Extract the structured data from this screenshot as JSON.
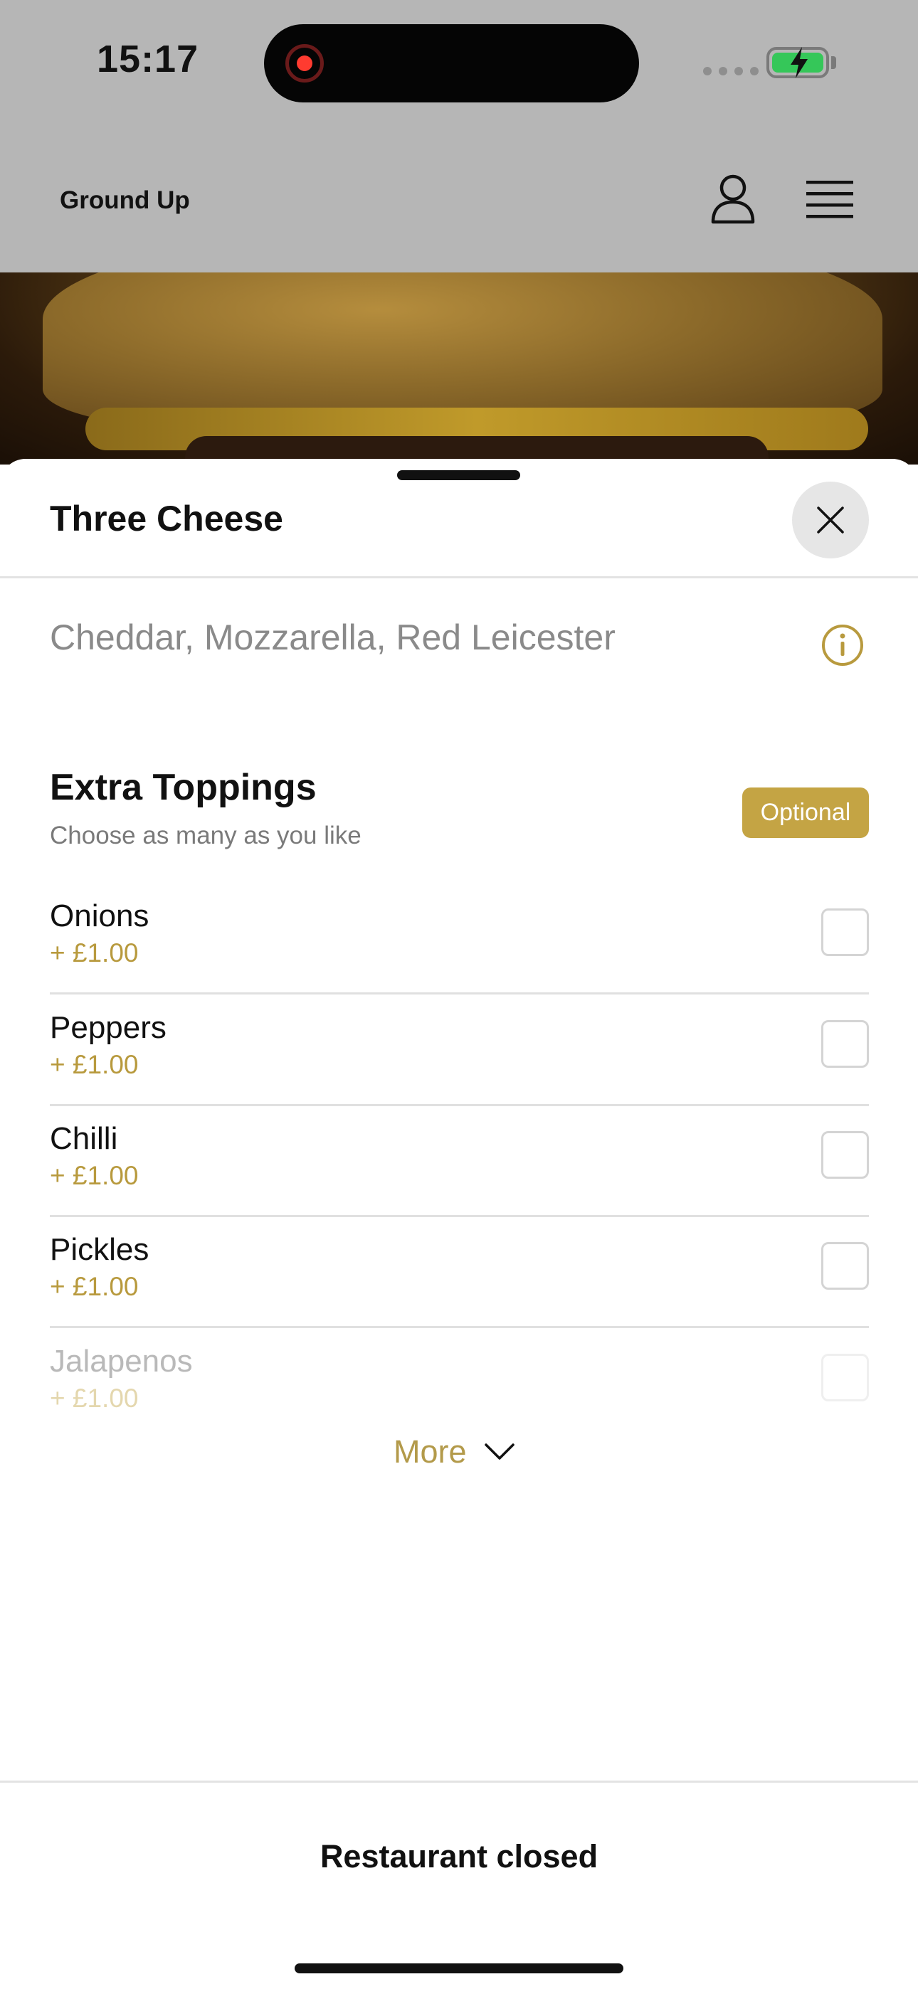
{
  "status_bar": {
    "time": "15:17"
  },
  "header": {
    "brand": "Ground Up"
  },
  "sheet": {
    "title": "Three Cheese",
    "description": "Cheddar, Mozzarella, Red Leicester"
  },
  "section": {
    "title": "Extra Toppings",
    "subtitle": "Choose as many as you like",
    "badge": "Optional"
  },
  "options": [
    {
      "name": "Onions",
      "price": "+ £1.00"
    },
    {
      "name": "Peppers",
      "price": "+ £1.00"
    },
    {
      "name": "Chilli",
      "price": "+ £1.00"
    },
    {
      "name": "Pickles",
      "price": "+ £1.00"
    },
    {
      "name": "Jalapenos",
      "price": "+ £1.00"
    }
  ],
  "more_label": "More",
  "footer": {
    "text": "Restaurant closed"
  },
  "colors": {
    "accent": "#c4a444",
    "price": "#b89a3e",
    "header_dim": "#b6b6b6",
    "battery": "#35c759"
  },
  "icons": [
    "record-icon",
    "signal-icon",
    "battery-icon",
    "user-icon",
    "menu-icon",
    "close-icon",
    "info-icon",
    "chevron-down-icon"
  ]
}
